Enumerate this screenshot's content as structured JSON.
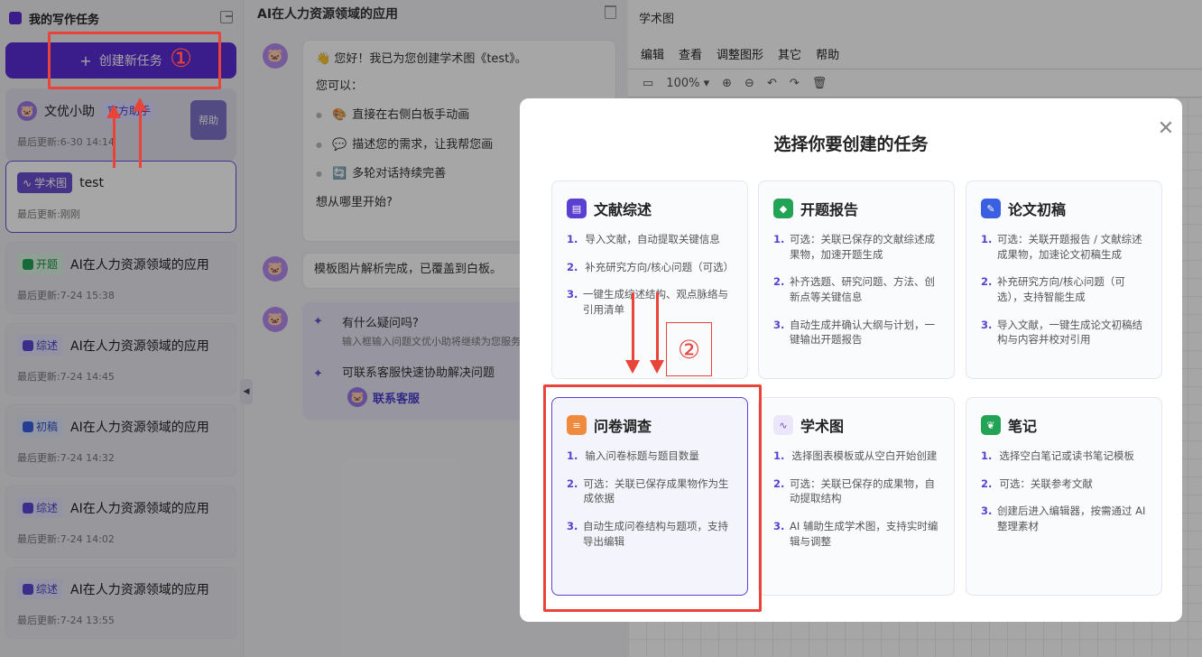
{
  "sidebar": {
    "title": "我的写作任务",
    "new_task": "创建新任务",
    "helper": {
      "name": "文优小助",
      "tag": "官方助手",
      "time": "最后更新:6-30 14:14",
      "img_label": "帮助"
    },
    "tasks": [
      {
        "tag": "学术图",
        "title": "test",
        "time": "最后更新:刚刚"
      },
      {
        "tag": "开题",
        "title": "AI在人力资源领域的应用",
        "time": "最后更新:7-24 15:38"
      },
      {
        "tag": "综述",
        "title": "AI在人力资源领域的应用",
        "time": "最后更新:7-24 14:45"
      },
      {
        "tag": "初稿",
        "title": "AI在人力资源领域的应用",
        "time": "最后更新:7-24 14:32"
      },
      {
        "tag": "综述",
        "title": "AI在人力资源领域的应用",
        "time": "最后更新:7-24 14:02"
      },
      {
        "tag": "综述",
        "title": "AI在人力资源领域的应用",
        "time": "最后更新:7-24 13:55"
      }
    ]
  },
  "chat": {
    "title": "AI在人力资源领域的应用",
    "msg1": {
      "greeting": "您好！我已为您创建学术图《test》。",
      "can": "您可以：",
      "items": [
        "直接在右侧白板手动画",
        "描述您的需求，让我帮您画",
        "多轮对话持续完善"
      ],
      "ask": "想从哪里开始?"
    },
    "msg2": "模板图片解析完成，已覆盖到白板。",
    "faq": {
      "q1": "有什么疑问吗?",
      "s1": "输入框输入问题文优小助将继续为您服务",
      "q2": "可联系客服快速协助解决问题",
      "cs": "联系客服"
    }
  },
  "editor": {
    "title": "学术图",
    "menu": [
      "编辑",
      "查看",
      "调整图形",
      "其它",
      "帮助"
    ],
    "zoom": "100%"
  },
  "modal": {
    "title": "选择你要创建的任务",
    "options": [
      {
        "name": "文献综述",
        "steps": [
          "导入文献，自动提取关键信息",
          "补充研究方向/核心问题（可选）",
          "一键生成综述结构、观点脉络与引用清单"
        ]
      },
      {
        "name": "开题报告",
        "steps": [
          "可选：关联已保存的文献综述成果物，加速开题生成",
          "补齐选题、研究问题、方法、创新点等关键信息",
          "自动生成并确认大纲与计划，一键输出开题报告"
        ]
      },
      {
        "name": "论文初稿",
        "steps": [
          "可选：关联开题报告 / 文献综述成果物，加速论文初稿生成",
          "补充研究方向/核心问题（可选），支持智能生成",
          "导入文献，一键生成论文初稿结构与内容并校对引用"
        ]
      },
      {
        "name": "问卷调查",
        "steps": [
          "输入问卷标题与题目数量",
          "可选：关联已保存成果物作为生成依据",
          "自动生成问卷结构与题项，支持导出编辑"
        ]
      },
      {
        "name": "学术图",
        "steps": [
          "选择图表模板或从空白开始创建",
          "可选：关联已保存的成果物，自动提取结构",
          "AI 辅助生成学术图，支持实时编辑与调整"
        ]
      },
      {
        "name": "笔记",
        "steps": [
          "选择空白笔记或读书笔记模板",
          "可选：关联参考文献",
          "创建后进入编辑器，按需通过 AI 整理素材"
        ]
      }
    ]
  },
  "annotations": {
    "mark1": "①",
    "mark2": "②"
  },
  "colors": {
    "accent": "#5b2bd6",
    "highlight": "#e8443a"
  }
}
